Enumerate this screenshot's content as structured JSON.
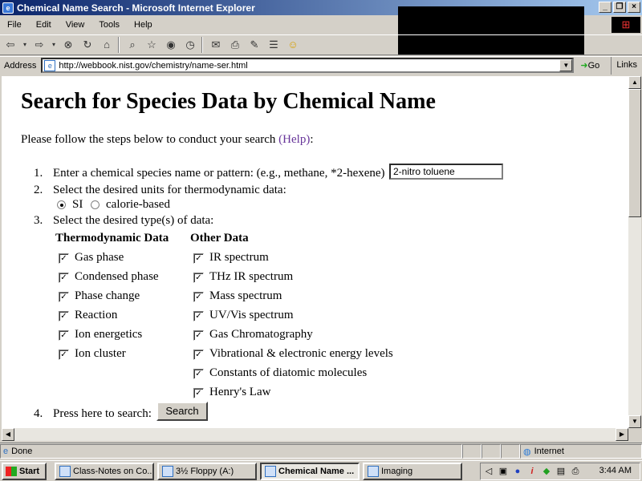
{
  "window": {
    "title": "Chemical Name Search - Microsoft Internet Explorer",
    "buttons": [
      "_",
      "❐",
      "×"
    ]
  },
  "menu": [
    "File",
    "Edit",
    "View",
    "Tools",
    "Help"
  ],
  "address": {
    "label": "Address",
    "url": "http://webbook.nist.gov/chemistry/name-ser.html",
    "go_label": "Go",
    "links_label": "Links"
  },
  "page": {
    "heading": "Search for Species Data by Chemical Name",
    "intro_prefix": "Please follow the steps below to conduct your search ",
    "intro_help": "(Help)",
    "intro_suffix": ":",
    "step1_num": "1.",
    "step1_text": "Enter a chemical species name or pattern: (e.g., methane, *2-hexene)",
    "name_value": "2-nitro toluene",
    "step2_num": "2.",
    "step2_text": "Select the desired units for thermodynamic data:",
    "unit_si": "SI",
    "unit_cal": "calorie-based",
    "units_selected": "SI",
    "step3_num": "3.",
    "step3_text": "Select the desired type(s) of data:",
    "thermo_head": "Thermodynamic Data",
    "other_head": "Other Data",
    "thermo_items": [
      "Gas phase",
      "Condensed phase",
      "Phase change",
      "Reaction",
      "Ion energetics",
      "Ion cluster"
    ],
    "other_items": [
      "IR spectrum",
      "THz IR spectrum",
      "Mass spectrum",
      "UV/Vis spectrum",
      "Gas Chromatography",
      "Vibrational & electronic energy levels",
      "Constants of diatomic molecules",
      "Henry's Law"
    ],
    "step4_num": "4.",
    "step4_text": "Press here to search:",
    "search_label": "Search"
  },
  "status": {
    "text": "Done",
    "zone": "Internet"
  },
  "taskbar": {
    "start": "Start",
    "tasks": [
      "Class-Notes on Co...",
      "3½ Floppy (A:)",
      "Chemical Name ...",
      "Imaging"
    ],
    "clock": "3:44 AM"
  }
}
